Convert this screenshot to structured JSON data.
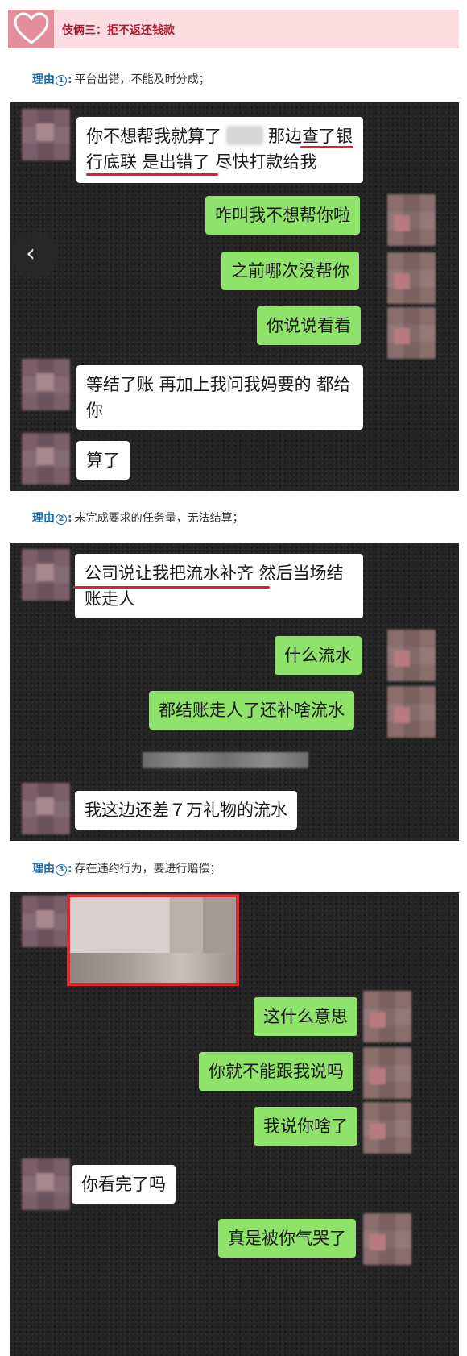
{
  "header": {
    "title": "伎俩三：拒不返还钱款",
    "icon": "heart-icon"
  },
  "reasons": [
    {
      "label": "理由",
      "num": "1",
      "text": "平台出错，不能及时分成；"
    },
    {
      "label": "理由",
      "num": "2",
      "text": "未完成要求的任务量，无法结算；"
    },
    {
      "label": "理由",
      "num": "3",
      "text": "存在违约行为，要进行赔偿；"
    }
  ],
  "chat1": {
    "m1a": "你不想帮我就算了",
    "m1b": "那边查了银",
    "m1c": "行底联 是出错了 尽快打款给我",
    "m2": "咋叫我不想帮你啦",
    "m3": "之前哪次没帮你",
    "m4": "你说说看看",
    "m5": "等结了账 再加上我问我妈要的 都给你",
    "m6": "算了"
  },
  "chat2": {
    "m1": "公司说让我把流水补齐 然后当场结账走人",
    "m2": "什么流水",
    "m3": "都结账走人了还补啥流水",
    "m4": "我这边还差７万礼物的流水"
  },
  "chat3": {
    "m1": "这什么意思",
    "m2": "你就不能跟我说吗",
    "m3": "我说你啥了",
    "m4": "你看完了吗",
    "m5": "真是被你气哭了"
  },
  "nav": {
    "prev_glyph": "‹"
  },
  "colors": {
    "accent": "#b01830",
    "header_bg": "#fbdde2",
    "reason_label": "#1f6fae",
    "green_bubble": "#8fe36b",
    "underline": "#d9232f"
  }
}
